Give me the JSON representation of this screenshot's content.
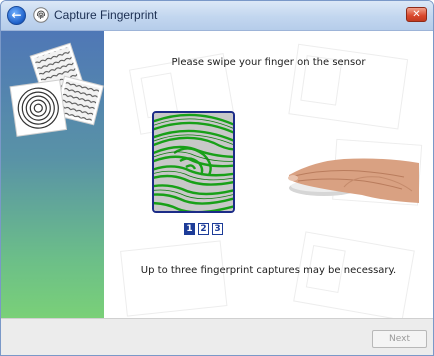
{
  "window": {
    "title": "Capture Fingerprint"
  },
  "titlebar": {
    "back_icon": "back-arrow-icon",
    "app_icon": "fingerprint-icon",
    "close_icon": "close-icon",
    "close_color": "#d9472c"
  },
  "main": {
    "instruction": "Please swipe your finger on the sensor",
    "steps": [
      "1",
      "2",
      "3"
    ],
    "active_step": "1",
    "note": "Up to three fingerprint captures may be necessary."
  },
  "footer": {
    "next_label": "Next"
  },
  "colors": {
    "fingerprint_ridges": "#1aa01a",
    "scanner_frame": "#1c2c88",
    "step_active": "#1d3c98"
  }
}
